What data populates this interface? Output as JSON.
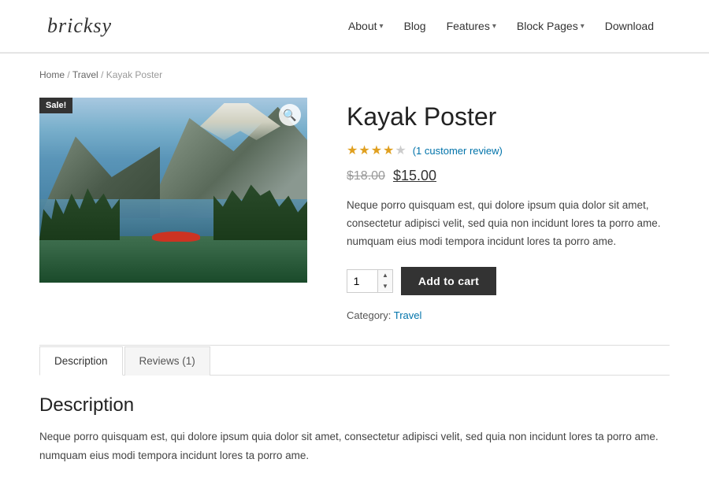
{
  "header": {
    "logo": "bricksy",
    "nav": [
      {
        "label": "About",
        "has_dropdown": true
      },
      {
        "label": "Blog",
        "has_dropdown": false
      },
      {
        "label": "Features",
        "has_dropdown": true
      },
      {
        "label": "Block Pages",
        "has_dropdown": true
      },
      {
        "label": "Download",
        "has_dropdown": false
      }
    ]
  },
  "breadcrumb": {
    "home": "Home",
    "category": "Travel",
    "current": "Kayak Poster"
  },
  "product": {
    "sale_badge": "Sale!",
    "title": "Kayak Poster",
    "rating": 4,
    "max_rating": 5,
    "review_text": "(1 customer review)",
    "price_old": "$18.00",
    "price_new": "$15.00",
    "description": "Neque porro quisquam est, qui dolore ipsum quia dolor sit amet, consectetur adipisci velit, sed quia non incidunt lores ta porro ame. numquam eius modi tempora incidunt lores ta porro ame.",
    "quantity": 1,
    "add_to_cart_label": "Add to cart",
    "category_label": "Category:",
    "category": "Travel"
  },
  "tabs": [
    {
      "label": "Description",
      "active": true
    },
    {
      "label": "Reviews (1)",
      "active": false
    }
  ],
  "description_section": {
    "heading": "Description",
    "text": "Neque porro quisquam est, qui dolore ipsum quia dolor sit amet, consectetur adipisci velit, sed quia non incidunt lores ta porro ame. numquam eius modi tempora incidunt lores ta porro ame."
  }
}
